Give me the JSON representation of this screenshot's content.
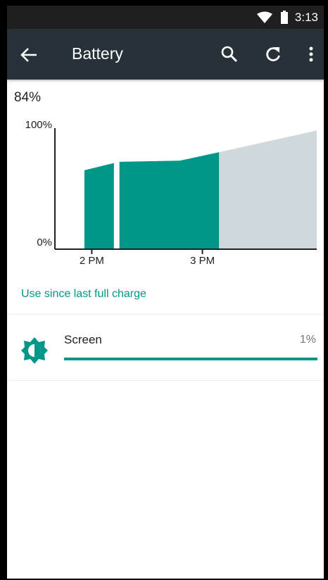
{
  "status_bar": {
    "time": "3:13",
    "icons": [
      "wifi-icon",
      "battery-icon"
    ]
  },
  "app_bar": {
    "title": "Battery",
    "icons": [
      "back-arrow-icon",
      "search-icon",
      "refresh-icon",
      "more-vert-icon"
    ]
  },
  "battery": {
    "level": "84%"
  },
  "chart_data": {
    "type": "area",
    "y_ticks": [
      "100%",
      "0%"
    ],
    "x_ticks": [
      "2 PM",
      "3 PM"
    ],
    "ylim": [
      0,
      100
    ],
    "series": [
      {
        "segments": [
          {
            "x": [
              "1:56 PM",
              "2:12 PM"
            ],
            "y": [
              65,
              71
            ]
          },
          {
            "x": [
              "2:15 PM",
              "2:48 PM",
              "3:09 PM"
            ],
            "y": [
              72,
              73,
              80
            ]
          }
        ]
      }
    ],
    "projection": {
      "x": [
        "3:09 PM",
        "4:02 PM"
      ],
      "y": [
        80,
        98
      ]
    },
    "colors": {
      "usage": "#009688",
      "projection": "#cfd8dc",
      "axis": "#212121"
    }
  },
  "usage_link": "Use since last full charge",
  "usage_items": [
    {
      "icon": "brightness-icon",
      "label": "Screen",
      "percent": "1%",
      "fraction": 1.0
    }
  ],
  "colors": {
    "accent": "#009688",
    "app_bar": "#263238",
    "status_bar": "#1f1f1f"
  }
}
